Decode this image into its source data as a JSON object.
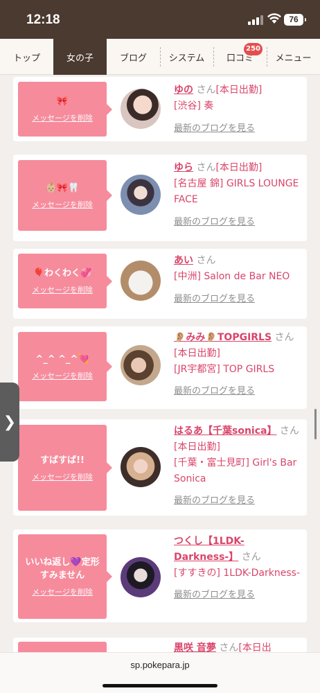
{
  "status": {
    "time": "12:18",
    "battery": "76"
  },
  "nav": {
    "tabs": [
      {
        "label": "トップ",
        "active": false
      },
      {
        "label": "女の子",
        "active": true
      },
      {
        "label": "ブログ",
        "active": false
      },
      {
        "label": "システム",
        "active": false
      },
      {
        "label": "口コミ",
        "active": false,
        "badge": "250"
      },
      {
        "label": "メニュー",
        "active": false
      }
    ]
  },
  "common": {
    "delete_label": "メッセージを削除",
    "blog_link": "最新のブログを見る",
    "san": "さん"
  },
  "girls": [
    {
      "message": "🎀",
      "name": "ゆの",
      "status": "[本日出勤]",
      "area": "[渋谷]",
      "shop": "奏"
    },
    {
      "message": "👶🏼🎀🦷",
      "name": "ゆら",
      "status": "[本日出勤]",
      "area": "[名古屋 錦]",
      "shop": "GIRLS LOUNGE FACE"
    },
    {
      "message": "🎈わくわく💞",
      "name": "あい",
      "status": "",
      "area": "[中洲]",
      "shop": "Salon de Bar NEO"
    },
    {
      "message": "^_^ ^_^💘",
      "name": "👂🏼みみ👂🏼TOPGIRLS",
      "status": "[本日出勤]",
      "area": "[JR宇都宮]",
      "shop": "TOP GIRLS"
    },
    {
      "message": "すばすば!!",
      "name": "はるあ【千葉sonica】",
      "status": "[本日出勤]",
      "area": "[千葉・富士見町]",
      "shop": "Girl's Bar Sonica"
    },
    {
      "message": "いいね返し💜定形すみません",
      "name": "つくし【1LDK-Darkness-】",
      "status": "",
      "area": "[すすきの]",
      "shop": "1LDK-Darkness-"
    },
    {
      "message": "",
      "name": "黒咲 音夢",
      "status": "[本日出",
      "area": "",
      "shop": ""
    }
  ],
  "side_toggle": "❯",
  "browser": {
    "url": "sp.pokepara.jp"
  },
  "colors": {
    "accent": "#d9456a",
    "message_bg": "#f68b9c",
    "nav_active": "#4a3a30"
  }
}
